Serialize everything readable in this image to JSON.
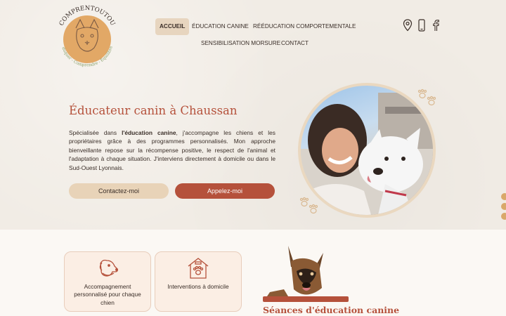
{
  "brand": {
    "name": "COMPRENTOUTOU",
    "tagline": "Éduquer - Comprendre - Équilibrer"
  },
  "nav": {
    "items": [
      {
        "label": "ACCUEIL",
        "active": true
      },
      {
        "label": "ÉDUCATION CANINE",
        "active": false
      },
      {
        "label": "RÉÉDUCATION COMPORTEMENTALE",
        "active": false
      },
      {
        "label": "SENSIBILISATION MORSURE",
        "active": false
      },
      {
        "label": "CONTACT",
        "active": false
      }
    ]
  },
  "header_icons": [
    "location-pin-icon",
    "phone-icon",
    "facebook-icon"
  ],
  "hero": {
    "title": "Éducateur canin à Chaussan",
    "text_before": "Spécialisée dans ",
    "text_bold": "l'éducation canine",
    "text_after": ", j'accompagne les chiens et les propriétaires grâce à des programmes personnalisés. Mon approche bienveillante repose sur la récompense positive, le respect de l'animal et l'adaptation à chaque situation. J'interviens directement à domicile ou dans le Sud-Ouest Lyonnais.",
    "btn_contact": "Contactez-moi",
    "btn_call": "Appelez-moi"
  },
  "features": [
    {
      "icon": "dog-head-icon",
      "label": "Accompagnement personnalisé pour chaque chien"
    },
    {
      "icon": "dog-house-icon",
      "label": "Interventions à domicile"
    }
  ],
  "section": {
    "title": "Séances d'éducation canine"
  },
  "colors": {
    "accent": "#b5513b",
    "beige": "#e8d3b8",
    "hero_bg": "#f1ece5",
    "page_bg": "#fbf8f4",
    "card_bg": "#fbeee4"
  }
}
